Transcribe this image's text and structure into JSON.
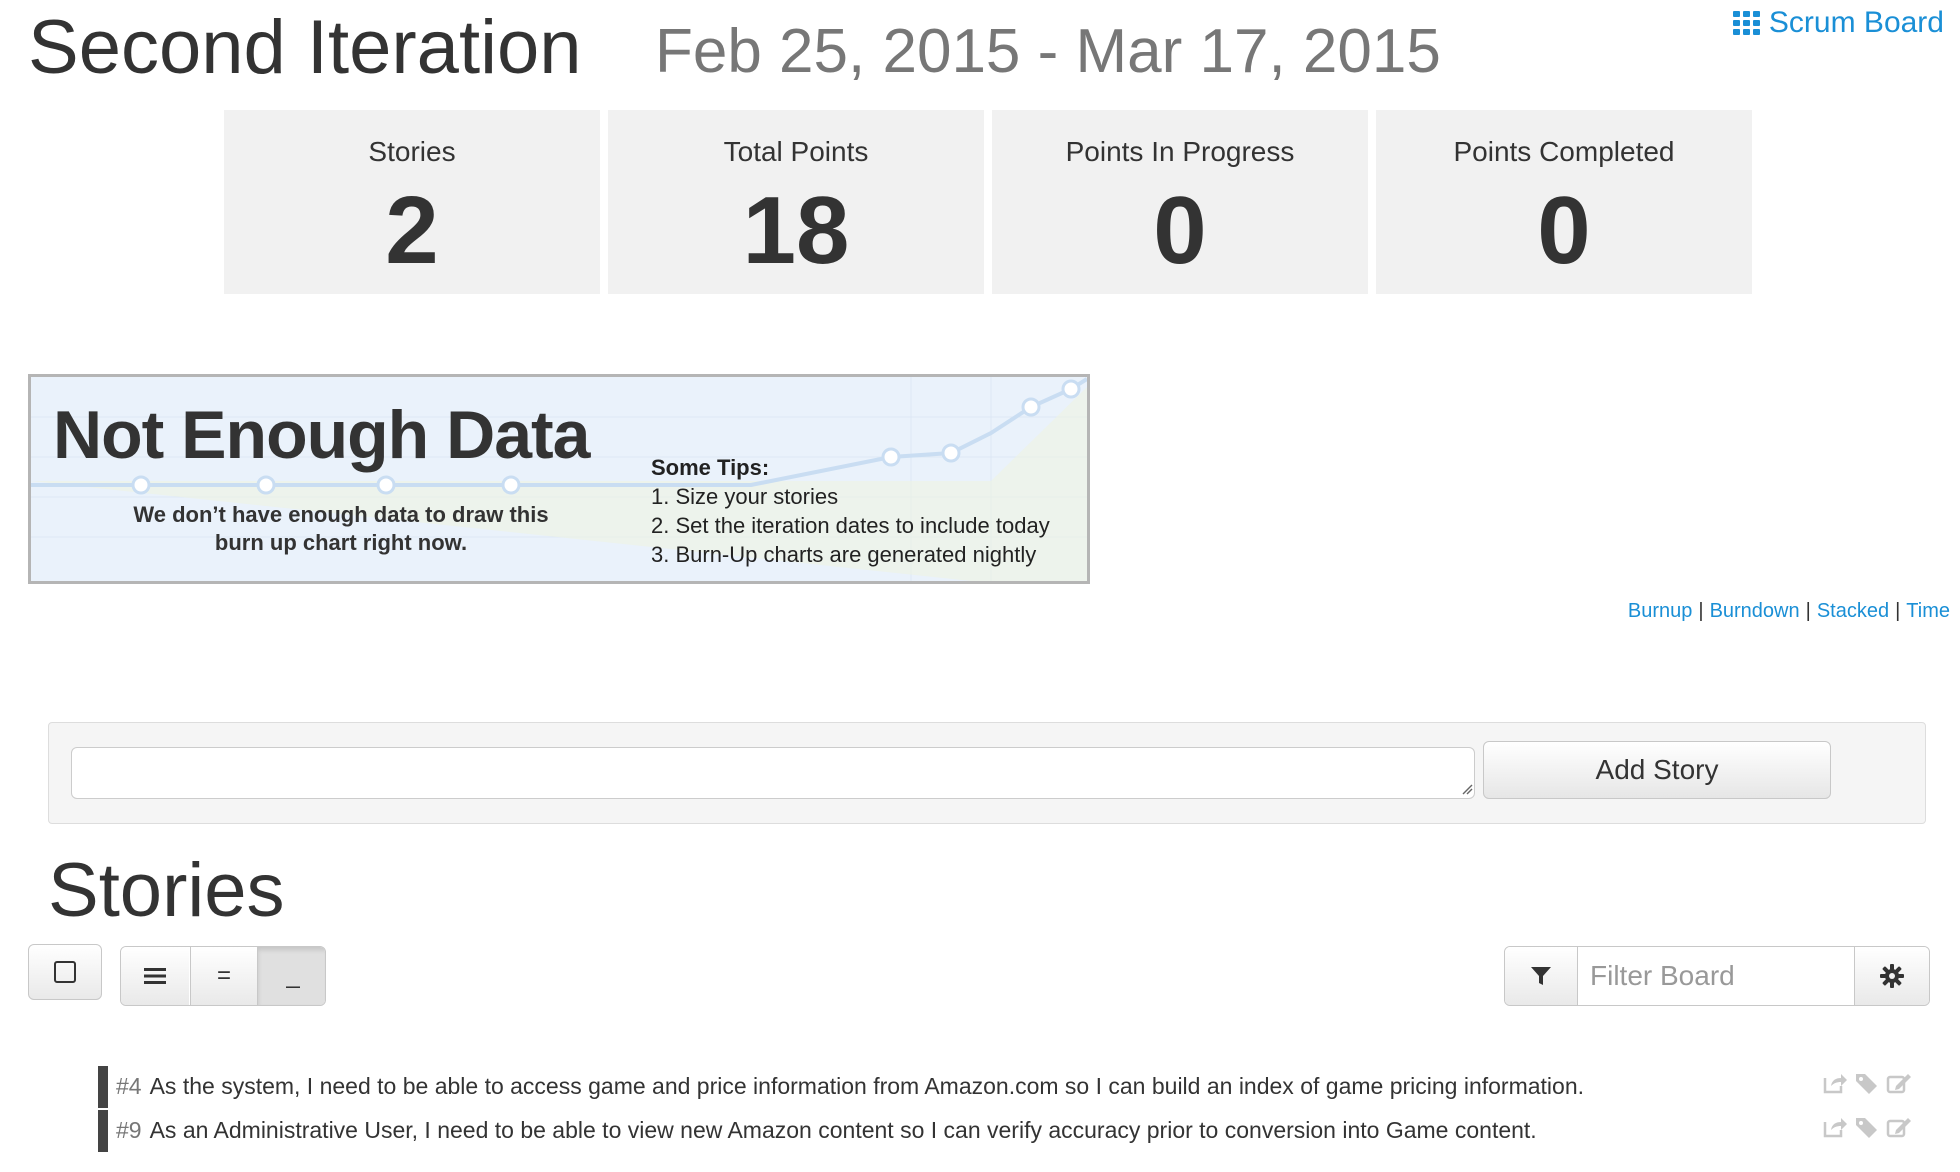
{
  "header": {
    "title": "Second Iteration",
    "dates": "Feb 25, 2015 - Mar 17, 2015",
    "scrum_board_label": "Scrum Board",
    "scrum_board_icon": "grid-icon"
  },
  "stats": [
    {
      "label": "Stories",
      "value": "2"
    },
    {
      "label": "Total Points",
      "value": "18"
    },
    {
      "label": "Points In Progress",
      "value": "0"
    },
    {
      "label": "Points Completed",
      "value": "0"
    }
  ],
  "chart_placeholder": {
    "title": "Not Enough Data",
    "message_line1": "We don’t have enough data to draw this",
    "message_line2": "burn up chart right now.",
    "tips_title": "Some Tips:",
    "tips": [
      "1. Size your stories",
      "2. Set the iteration dates to include today",
      "3. Burn-Up charts are generated nightly"
    ]
  },
  "chart_links": [
    "Burnup",
    "Burndown",
    "Stacked",
    "Time"
  ],
  "add_story": {
    "textarea_value": "",
    "button_label": "Add Story"
  },
  "stories_heading": "Stories",
  "toolbar": {
    "view_buttons": [
      "≡",
      "=",
      "_"
    ],
    "filter_placeholder": "Filter Board",
    "filter_icon": "filter-icon",
    "settings_icon": "gear-icon"
  },
  "stories": [
    {
      "id": "#4",
      "text": "As the system, I need to be able to access game and price information from Amazon.com so I can build an index of game pricing information."
    },
    {
      "id": "#9",
      "text": "As an Administrative User, I need to be able to view new Amazon content so I can verify accuracy prior to conversion into Game content."
    }
  ],
  "colors": {
    "link": "#1a8fd6",
    "stat_box_bg": "#f1f1f1",
    "story_bar": "#444444",
    "dates_text": "#777777"
  }
}
